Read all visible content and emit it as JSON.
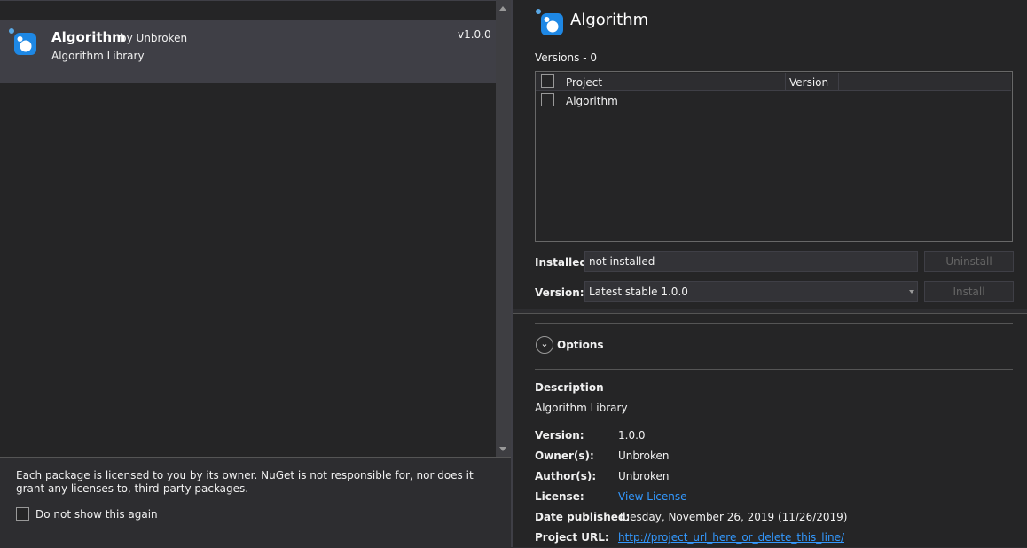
{
  "package_list": {
    "items": [
      {
        "title": "Algorithm",
        "by": "by Unbroken",
        "description": "Algorithm Library",
        "version": "v1.0.0",
        "icon": "nuget-package-icon"
      }
    ]
  },
  "license_notice": {
    "text": "Each package is licensed to you by its owner. NuGet is not responsible for, nor does it grant any licenses to, third-party packages.",
    "dont_show_label": "Do not show this again",
    "dont_show_checked": false
  },
  "details": {
    "title": "Algorithm",
    "versions_label": "Versions - 0",
    "table": {
      "columns": [
        "Project",
        "Version"
      ],
      "rows": [
        {
          "project": "Algorithm",
          "version": "",
          "checked": false
        }
      ]
    },
    "installed_label": "Installed:",
    "installed_value": "not installed",
    "uninstall_label": "Uninstall",
    "version_label": "Version:",
    "version_value": "Latest stable 1.0.0",
    "install_label": "Install",
    "options_label": "Options",
    "description_heading": "Description",
    "description_text": "Algorithm Library",
    "metadata": {
      "version_key": "Version:",
      "version_val": "1.0.0",
      "owners_key": "Owner(s):",
      "owners_val": "Unbroken",
      "authors_key": "Author(s):",
      "authors_val": "Unbroken",
      "license_key": "License:",
      "license_val": "View License",
      "date_key": "Date published:",
      "date_val": "Tuesday, November 26, 2019 (11/26/2019)",
      "url_key": "Project URL:",
      "url_val": "http://project_url_here_or_delete_this_line/"
    }
  },
  "colors": {
    "background": "#252526",
    "selection": "#3f3f46",
    "link": "#3399ff",
    "icon_blue": "#1e88e5"
  }
}
